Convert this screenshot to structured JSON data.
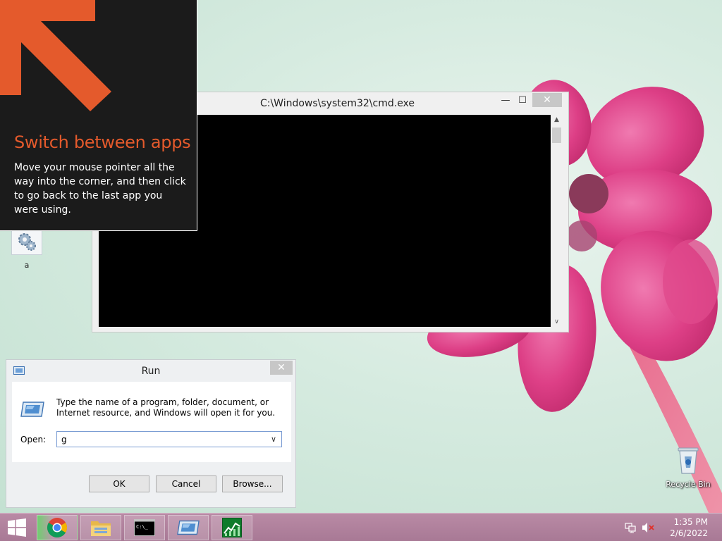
{
  "desktop": {
    "icons": [
      {
        "name": "settings-shortcut",
        "label": "a",
        "icon": "gears-icon"
      },
      {
        "name": "recycle-bin",
        "label": "Recycle Bin",
        "icon": "recycle-bin-icon"
      }
    ]
  },
  "tip": {
    "heading": "Switch between apps",
    "body": "Move your mouse pointer all the way into the corner, and then click to go back to the last app you were using.",
    "accent_color": "#e45a2c",
    "icon": "arrow-up-left-icon"
  },
  "cmd_window": {
    "title": "C:\\Windows\\system32\\cmd.exe",
    "minimize_glyph": "—",
    "maximize_glyph": "☐",
    "close_glyph": "✕",
    "scroll_up_glyph": "▲",
    "scroll_down_glyph": "∨"
  },
  "run_dialog": {
    "title": "Run",
    "close_glyph": "✕",
    "description": "Type the name of a program, folder, document, or Internet resource, and Windows will open it for you.",
    "open_label": "Open:",
    "open_value": "g",
    "caret_glyph": "∨",
    "buttons": {
      "ok": "OK",
      "cancel": "Cancel",
      "browse": "Browse..."
    }
  },
  "taskbar": {
    "items": [
      {
        "name": "start",
        "icon": "windows-logo-icon"
      },
      {
        "name": "chrome",
        "icon": "chrome-icon",
        "running": true
      },
      {
        "name": "file-explorer",
        "icon": "folder-icon",
        "running": true
      },
      {
        "name": "cmd",
        "icon": "cmd-icon",
        "running": true
      },
      {
        "name": "run",
        "icon": "run-icon",
        "running": true
      },
      {
        "name": "task-manager",
        "icon": "task-manager-icon",
        "running": true
      }
    ],
    "cmd_icon_text": "C:\\_",
    "tray": {
      "network_icon": "network-icon",
      "volume_icon": "volume-muted-icon",
      "time": "1:35 PM",
      "date": "2/6/2022"
    },
    "color": "#b98aa5"
  }
}
